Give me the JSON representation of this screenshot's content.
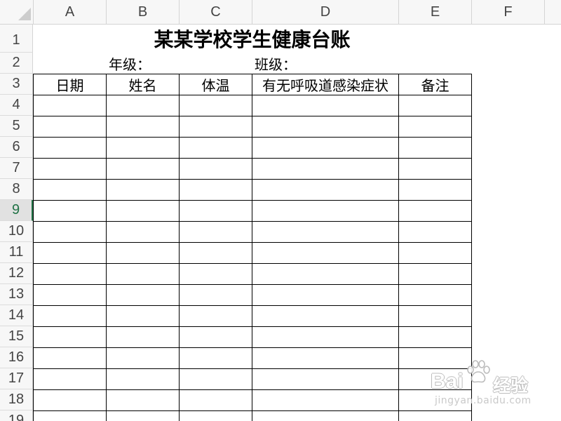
{
  "spreadsheet": {
    "column_headers": [
      "A",
      "B",
      "C",
      "D",
      "E",
      "F"
    ],
    "row_headers": [
      "1",
      "2",
      "3",
      "4",
      "5",
      "6",
      "7",
      "8",
      "9",
      "10",
      "11",
      "12",
      "13",
      "14",
      "15",
      "16",
      "17",
      "18",
      "19"
    ],
    "cells": {
      "A1": "某某学校学生健康台账",
      "B2": "年级：",
      "D2": "班级：",
      "A3": "日期",
      "B3": "姓名",
      "C3": "体温",
      "D3": "有无呼吸道感染症状",
      "E3": "备注"
    },
    "gridlines": false
  },
  "colors": {
    "selection_accent": "#217346",
    "table_border": "#000000",
    "header_background": "#f7f7f7",
    "header_text": "#444444"
  },
  "icons": {
    "select_all": "select-all-triangle-icon",
    "watermark_logo": "paw-icon"
  },
  "watermark": {
    "brand": "Bai",
    "product": "经验",
    "url": "jingyan.baidu.com"
  }
}
